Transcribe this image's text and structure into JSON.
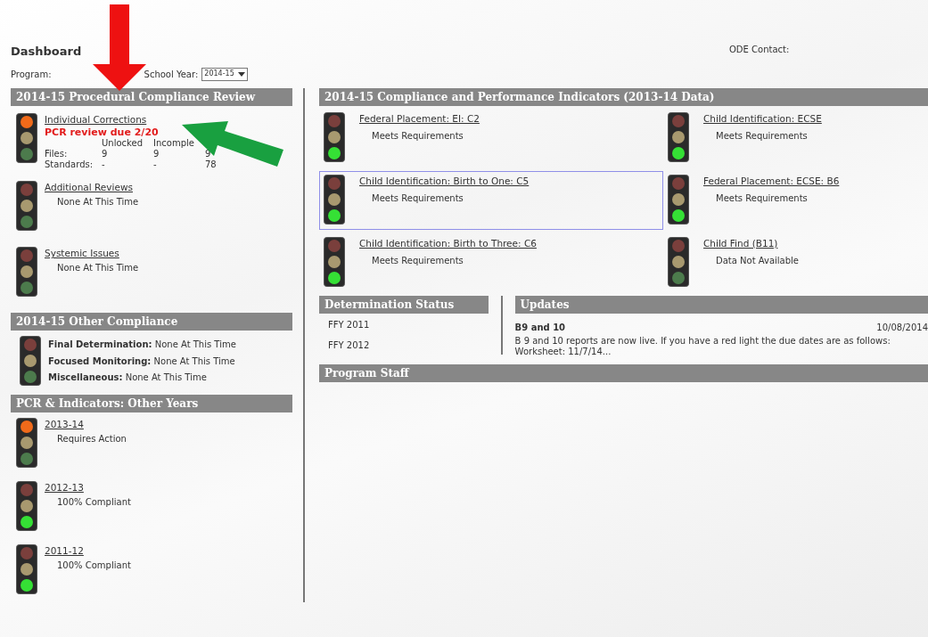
{
  "header": {
    "title": "Dashboard",
    "contact_label": "ODE Contact:"
  },
  "filters": {
    "program_label": "Program:",
    "school_year_label": "School Year:",
    "school_year_value": "2014-15"
  },
  "pcr": {
    "title": "2014-15 Procedural Compliance Review",
    "items": [
      {
        "kind": "table",
        "title": "Individual Corrections",
        "top_lit": true,
        "bottom_lit": false,
        "alert": "PCR review due 2/20",
        "columns": [
          "Unlocked",
          "Incomple"
        ],
        "rows": [
          {
            "label": "Files:",
            "values": [
              "9",
              "9",
              "9"
            ]
          },
          {
            "label": "Standards:",
            "values": [
              "-",
              "-",
              "78"
            ]
          }
        ]
      },
      {
        "kind": "status",
        "title": "Additional Reviews",
        "top_lit": false,
        "bottom_lit": false,
        "status": "None At This Time"
      },
      {
        "kind": "status",
        "title": "Systemic Issues",
        "top_lit": false,
        "bottom_lit": false,
        "status": "None At This Time"
      }
    ]
  },
  "other_compliance": {
    "title": "2014-15 Other Compliance",
    "top_lit": false,
    "bottom_lit": false,
    "lines": [
      {
        "label": "Final Determination:",
        "value": "None At This Time"
      },
      {
        "label": "Focused Monitoring:",
        "value": "None At This Time"
      },
      {
        "label": "Miscellaneous:",
        "value": "None At This Time"
      }
    ]
  },
  "other_years": {
    "title": "PCR & Indicators: Other Years",
    "items": [
      {
        "title": "2013-14",
        "top_lit": true,
        "bottom_lit": false,
        "status": "Requires Action"
      },
      {
        "title": "2012-13",
        "top_lit": false,
        "bottom_lit": true,
        "status": "100% Compliant"
      },
      {
        "title": "2011-12",
        "top_lit": false,
        "bottom_lit": true,
        "status": "100% Compliant"
      }
    ]
  },
  "indicators": {
    "title": "2014-15 Compliance and Performance Indicators (2013-14 Data)",
    "items": [
      {
        "title": "Federal Placement: EI: C2",
        "status": "Meets Requirements",
        "top_lit": false,
        "bottom_lit": true,
        "selected": false
      },
      {
        "title": "Child Identification: ECSE",
        "status": "Meets Requirements",
        "top_lit": false,
        "bottom_lit": true,
        "selected": false
      },
      {
        "title": "Child Identification: Birth to One: C5",
        "status": "Meets Requirements",
        "top_lit": false,
        "bottom_lit": true,
        "selected": true
      },
      {
        "title": "Federal Placement: ECSE: B6",
        "status": "Meets Requirements",
        "top_lit": false,
        "bottom_lit": true,
        "selected": false
      },
      {
        "title": "Child Identification: Birth to Three: C6",
        "status": "Meets Requirements",
        "top_lit": false,
        "bottom_lit": true,
        "selected": false
      },
      {
        "title": "Child Find (B11)",
        "status": "Data Not Available",
        "top_lit": false,
        "bottom_lit": false,
        "selected": false
      }
    ]
  },
  "determination": {
    "title": "Determination Status",
    "items": [
      "FFY 2011",
      "FFY 2012"
    ]
  },
  "updates": {
    "title": "Updates",
    "items": [
      {
        "title": "B9 and 10",
        "date": "10/08/2014",
        "body": "B 9 and 10 reports are now live. If you have a red light the due dates are as follows: Worksheet: 11/7/14..."
      }
    ]
  },
  "program_staff": {
    "title": "Program Staff"
  }
}
